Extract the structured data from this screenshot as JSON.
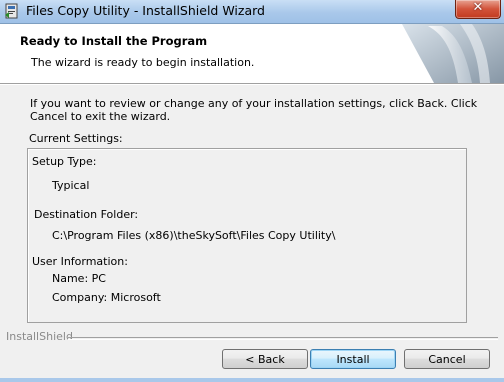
{
  "window": {
    "title": "Files Copy Utility - InstallShield Wizard",
    "close_glyph": "✕"
  },
  "banner": {
    "title": "Ready to Install the Program",
    "description": "The wizard is ready to begin installation."
  },
  "intro": {
    "text": "If you want to review or change any of your installation settings, click Back. Click Cancel to exit the wizard."
  },
  "settings": {
    "label": "Current Settings:",
    "setup_type_label": "Setup Type:",
    "setup_type_value": "Typical",
    "destination_label": "Destination Folder:",
    "destination_value": "C:\\Program Files (x86)\\theSkySoft\\Files Copy Utility\\",
    "user_info_label": "User Information:",
    "name": "Name: PC",
    "company": "Company: Microsoft"
  },
  "footer": {
    "brand": "InstallShield",
    "back_label": "< Back",
    "install_label": "Install",
    "cancel_label": "Cancel"
  },
  "colors": {
    "titlebar": "#a9c8ea",
    "close_button": "#c23a1f",
    "default_button_border": "#3c7fb1"
  }
}
